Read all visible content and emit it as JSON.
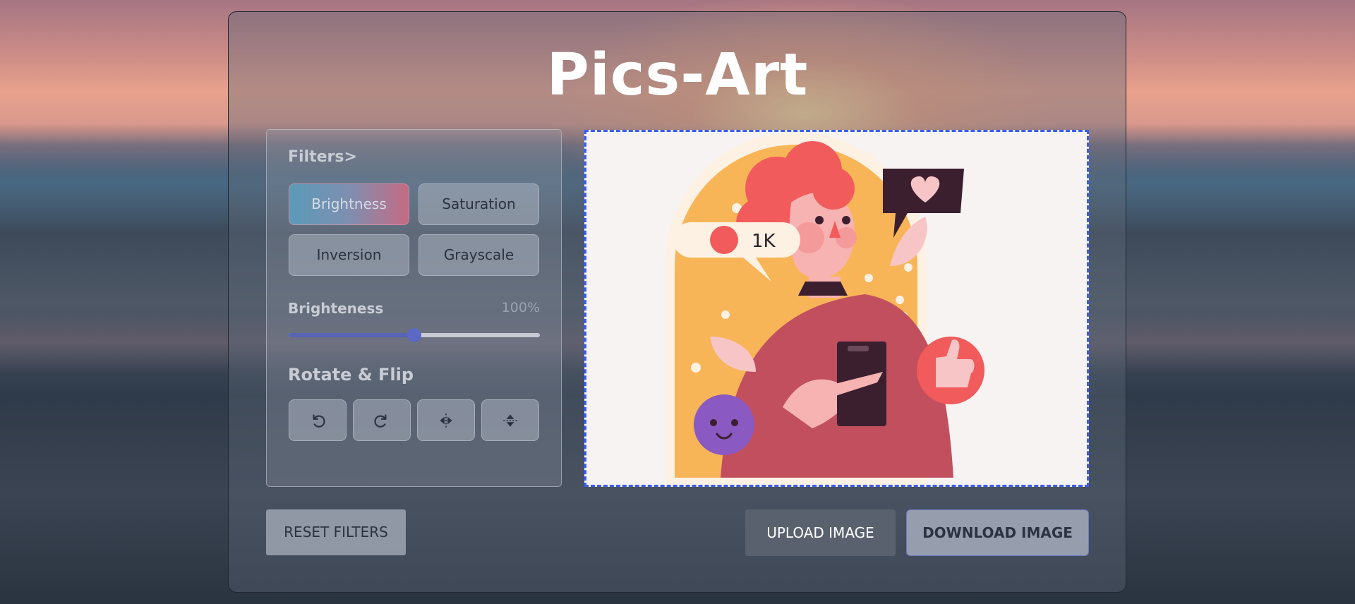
{
  "app": {
    "title": "Pics-Art"
  },
  "filters": {
    "heading": "Filters>",
    "buttons": [
      "Brightness",
      "Saturation",
      "Inversion",
      "Grayscale"
    ],
    "active": "Brightness"
  },
  "slider": {
    "label": "Brighteness",
    "value_text": "100%",
    "level_fraction": 0.5
  },
  "rotate_flip": {
    "heading": "Rotate & Flip",
    "icons": [
      "rotate-left-icon",
      "rotate-right-icon",
      "flip-horizontal-icon",
      "flip-vertical-icon"
    ]
  },
  "preview": {
    "badge_text": "1K"
  },
  "actions": {
    "reset": "RESET FILTERS",
    "upload": "UPLOAD IMAGE",
    "download": "DOWNLOAD IMAGE"
  },
  "colors": {
    "slider_fill": "#5864b6",
    "preview_border": "#3a5cf0",
    "upload_bg": "#5a616e"
  }
}
